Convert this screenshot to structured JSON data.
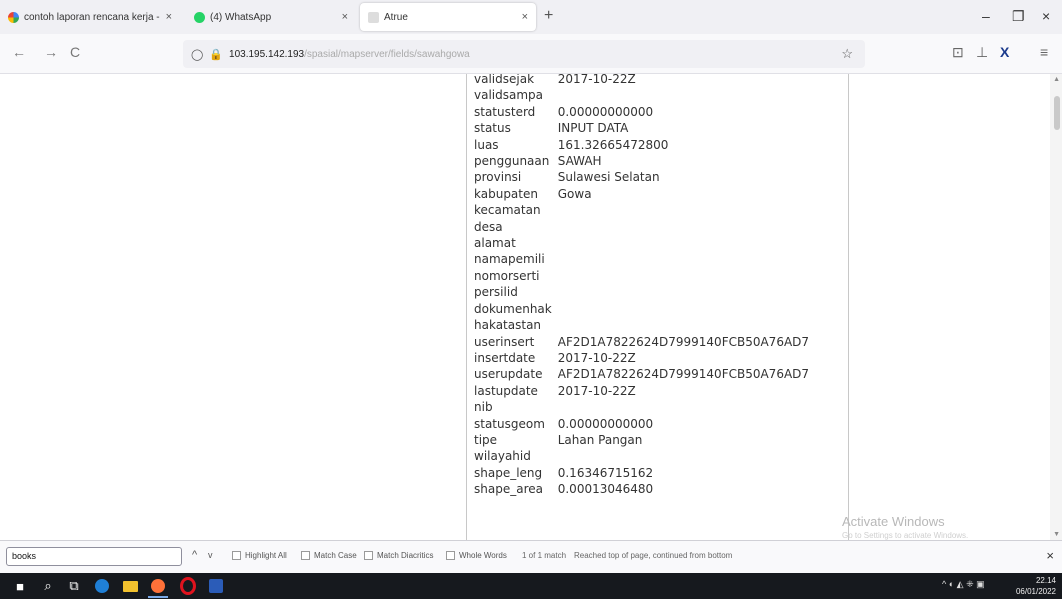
{
  "tabs": [
    {
      "label": "contoh laporan rencana kerja - ",
      "icon": "google-icon",
      "close": "×",
      "active": false
    },
    {
      "label": "(4) WhatsApp",
      "icon": "whatsapp-icon",
      "close": "×",
      "active": false
    },
    {
      "label": "Atrue",
      "icon": "page-icon",
      "close": "×",
      "active": true
    }
  ],
  "new_tab": "+",
  "window_controls": {
    "minimize": "–",
    "restore": "❐",
    "close": "×"
  },
  "nav": {
    "back": "←",
    "forward": "→",
    "reload": "C"
  },
  "url": {
    "host": "103.195.142.193",
    "path": "/spasial/mapserver/fields/sawahgowa",
    "shield": "◯",
    "lock": "🔒",
    "star": "☆"
  },
  "toolbar_icons": {
    "pocket": "⊡",
    "download": "⊥",
    "extension": "X",
    "menu": "≡"
  },
  "attributes": [
    {
      "key": "validsejak",
      "value": "2017-10-22Z"
    },
    {
      "key": "validsampa",
      "value": ""
    },
    {
      "key": "statusterd",
      "value": "0.00000000000"
    },
    {
      "key": "status",
      "value": "INPUT DATA"
    },
    {
      "key": "luas",
      "value": "161.32665472800"
    },
    {
      "key": "penggunaan",
      "value": "SAWAH"
    },
    {
      "key": "provinsi",
      "value": "Sulawesi Selatan"
    },
    {
      "key": "kabupaten",
      "value": "Gowa"
    },
    {
      "key": "kecamatan",
      "value": ""
    },
    {
      "key": "desa",
      "value": ""
    },
    {
      "key": "alamat",
      "value": ""
    },
    {
      "key": "namapemili",
      "value": ""
    },
    {
      "key": "nomorserti",
      "value": ""
    },
    {
      "key": "persilid",
      "value": ""
    },
    {
      "key": "dokumenhak",
      "value": ""
    },
    {
      "key": "hakatastan",
      "value": ""
    },
    {
      "key": "userinsert",
      "value": "AF2D1A7822624D7999140FCB50A76AD7"
    },
    {
      "key": "insertdate",
      "value": "2017-10-22Z"
    },
    {
      "key": "userupdate",
      "value": "AF2D1A7822624D7999140FCB50A76AD7"
    },
    {
      "key": "lastupdate",
      "value": "2017-10-22Z"
    },
    {
      "key": "nib",
      "value": ""
    },
    {
      "key": "statusgeom",
      "value": "0.00000000000"
    },
    {
      "key": "tipe",
      "value": "Lahan Pangan"
    },
    {
      "key": "wilayahid",
      "value": ""
    },
    {
      "key": "shape_leng",
      "value": "0.16346715162"
    },
    {
      "key": "shape_area",
      "value": "0.00013046480"
    }
  ],
  "watermark": {
    "title": "Activate Windows",
    "subtitle": "Go to Settings to activate Windows."
  },
  "find": {
    "query": "books",
    "prev": "^",
    "next": "v",
    "highlight_all": "Highlight All",
    "match_case": "Match Case",
    "match_diacritics": "Match Diacritics",
    "whole_words": "Whole Words",
    "result": "1 of 1 match",
    "status": "Reached top of page, continued from bottom",
    "close": "×"
  },
  "taskbar": {
    "start": "■",
    "search": "⌕",
    "task_view": "⧉",
    "tray": "^ ◐ ◭ ⁜ ▣",
    "time": "22.14",
    "date": "06/01/2022"
  },
  "colors": {
    "edge": "#1f7fd6",
    "explorer": "#f2c12e",
    "firefox": "#ff7139",
    "opera": "#e0131e",
    "word": "#2b5cb8"
  }
}
